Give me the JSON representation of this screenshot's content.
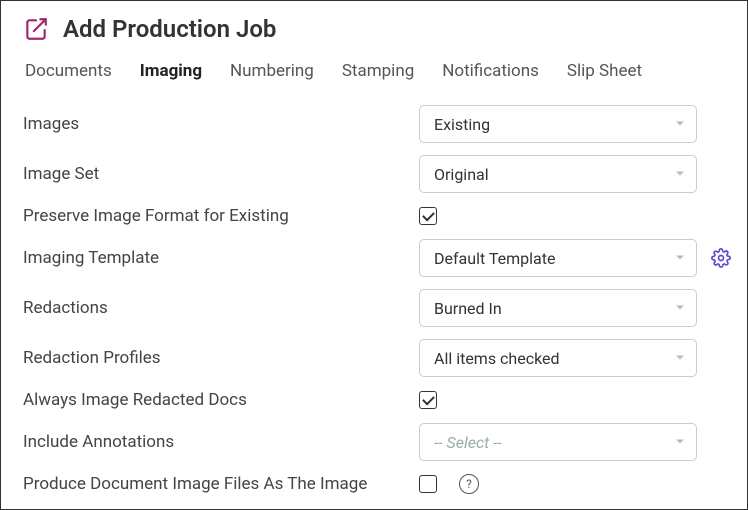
{
  "header": {
    "title": "Add Production Job",
    "icon": "share-icon"
  },
  "tabs": [
    {
      "label": "Documents",
      "active": false
    },
    {
      "label": "Imaging",
      "active": true
    },
    {
      "label": "Numbering",
      "active": false
    },
    {
      "label": "Stamping",
      "active": false
    },
    {
      "label": "Notifications",
      "active": false
    },
    {
      "label": "Slip Sheet",
      "active": false
    }
  ],
  "fields": {
    "images": {
      "label": "Images",
      "value": "Existing"
    },
    "image_set": {
      "label": "Image Set",
      "value": "Original"
    },
    "preserve_format": {
      "label": "Preserve Image Format for Existing",
      "checked": true
    },
    "imaging_template": {
      "label": "Imaging Template",
      "value": "Default Template"
    },
    "redactions": {
      "label": "Redactions",
      "value": "Burned In"
    },
    "redaction_profiles": {
      "label": "Redaction Profiles",
      "value": "All items checked"
    },
    "always_image_redacted": {
      "label": "Always Image Redacted Docs",
      "checked": true
    },
    "include_annotations": {
      "label": "Include Annotations",
      "value": "-- Select --",
      "placeholder": true
    },
    "produce_doc_image_files": {
      "label": "Produce Document Image Files As The Image",
      "checked": false
    }
  },
  "icons": {
    "gear": "gear-icon",
    "help": "help-icon",
    "caret": "chevron-down-icon"
  },
  "colors": {
    "accent_magenta": "#a2256f",
    "accent_purple": "#5b4bd9",
    "border_gray": "#cccccc",
    "text": "#333333"
  }
}
